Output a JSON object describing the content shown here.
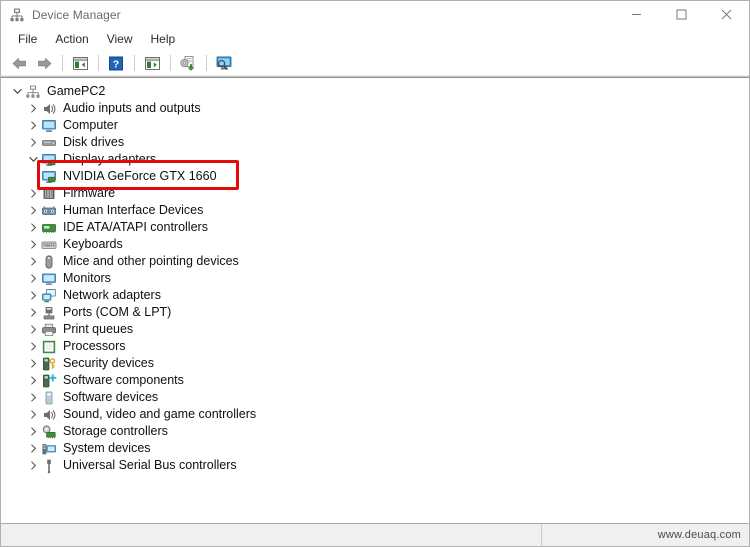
{
  "window": {
    "title": "Device Manager",
    "icon": "device-manager-icon",
    "controls": {
      "minimize": "minimize-icon",
      "maximize": "maximize-icon",
      "close": "close-icon"
    }
  },
  "menubar": {
    "items": [
      {
        "label": "File"
      },
      {
        "label": "Action"
      },
      {
        "label": "View"
      },
      {
        "label": "Help"
      }
    ]
  },
  "toolbar": {
    "buttons": [
      {
        "name": "back-arrow-icon"
      },
      {
        "name": "forward-arrow-icon"
      },
      {
        "name": "separator"
      },
      {
        "name": "show-hide-console-tree-icon"
      },
      {
        "name": "separator"
      },
      {
        "name": "help-icon"
      },
      {
        "name": "separator"
      },
      {
        "name": "properties-icon"
      },
      {
        "name": "separator"
      },
      {
        "name": "update-driver-icon"
      },
      {
        "name": "separator"
      },
      {
        "name": "scan-for-hardware-changes-icon"
      }
    ]
  },
  "tree": {
    "root": {
      "label": "GamePC2",
      "icon": "computer-root-icon",
      "expanded": true
    },
    "nodes": [
      {
        "label": "Audio inputs and outputs",
        "icon": "speaker-icon",
        "expanded": false
      },
      {
        "label": "Computer",
        "icon": "computer-icon",
        "expanded": false
      },
      {
        "label": "Disk drives",
        "icon": "disk-drive-icon",
        "expanded": false
      },
      {
        "label": "Display adapters",
        "icon": "display-adapter-icon",
        "expanded": true
      },
      {
        "label": "NVIDIA GeForce GTX 1660",
        "icon": "display-adapter-icon",
        "child": true,
        "highlighted": true
      },
      {
        "label": "Firmware",
        "icon": "firmware-icon",
        "expanded": false
      },
      {
        "label": "Human Interface Devices",
        "icon": "hid-icon",
        "expanded": false
      },
      {
        "label": "IDE ATA/ATAPI controllers",
        "icon": "ide-controller-icon",
        "expanded": false
      },
      {
        "label": "Keyboards",
        "icon": "keyboard-icon",
        "expanded": false
      },
      {
        "label": "Mice and other pointing devices",
        "icon": "mouse-icon",
        "expanded": false
      },
      {
        "label": "Monitors",
        "icon": "monitor-icon",
        "expanded": false
      },
      {
        "label": "Network adapters",
        "icon": "network-adapter-icon",
        "expanded": false
      },
      {
        "label": "Ports (COM & LPT)",
        "icon": "port-icon",
        "expanded": false
      },
      {
        "label": "Print queues",
        "icon": "printer-icon",
        "expanded": false
      },
      {
        "label": "Processors",
        "icon": "processor-icon",
        "expanded": false
      },
      {
        "label": "Security devices",
        "icon": "security-device-icon",
        "expanded": false
      },
      {
        "label": "Software components",
        "icon": "software-component-icon",
        "expanded": false
      },
      {
        "label": "Software devices",
        "icon": "software-device-icon",
        "expanded": false
      },
      {
        "label": "Sound, video and game controllers",
        "icon": "sound-controller-icon",
        "expanded": false
      },
      {
        "label": "Storage controllers",
        "icon": "storage-controller-icon",
        "expanded": false
      },
      {
        "label": "System devices",
        "icon": "system-device-icon",
        "expanded": false
      },
      {
        "label": "Universal Serial Bus controllers",
        "icon": "usb-controller-icon",
        "expanded": false
      }
    ]
  },
  "annotation": {
    "color": "#e40a0a",
    "target": "NVIDIA GeForce GTX 1660"
  },
  "statusbar": {
    "watermark": "www.deuaq.com"
  }
}
